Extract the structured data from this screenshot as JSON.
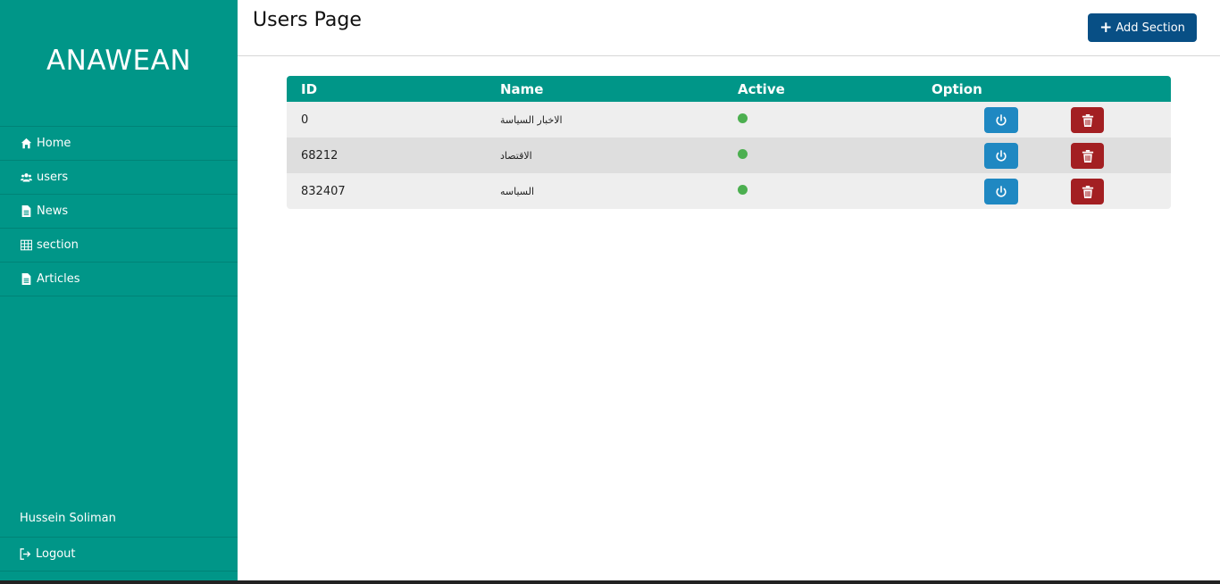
{
  "sidebar": {
    "brand": "ANAWEAN",
    "items": [
      {
        "label": "Home",
        "icon": "home-icon"
      },
      {
        "label": "users",
        "icon": "users-icon"
      },
      {
        "label": "News",
        "icon": "file-icon"
      },
      {
        "label": "section",
        "icon": "table-icon"
      },
      {
        "label": "Articles",
        "icon": "file-icon"
      }
    ],
    "user_name": "Hussein Soliman",
    "logout_label": "Logout",
    "logout_icon": "logout-icon"
  },
  "header": {
    "title": "Users Page",
    "add_button_label": "Add Section"
  },
  "table": {
    "columns": [
      "ID",
      "Name",
      "Active",
      "Option"
    ],
    "rows": [
      {
        "id": "0",
        "name": "الاخبار السياسة",
        "active": true
      },
      {
        "id": "68212",
        "name": "الاقتصاد",
        "active": true
      },
      {
        "id": "832407",
        "name": "السياسه",
        "active": true
      }
    ]
  },
  "colors": {
    "sidebar": "#009688",
    "header_row": "#009688",
    "add_button": "#084f85",
    "power_button": "#1f88c2",
    "delete_button": "#a31f22",
    "active_dot": "#4caf50"
  }
}
